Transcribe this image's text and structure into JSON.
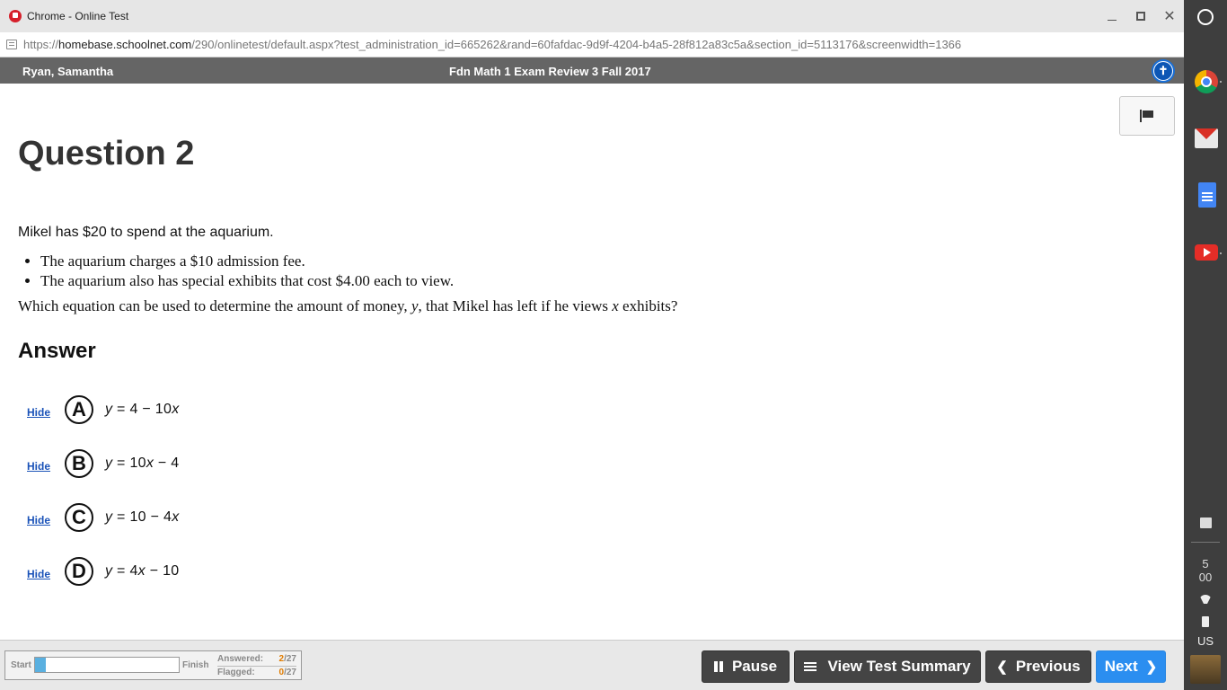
{
  "window": {
    "title": "Chrome - Online Test",
    "url_scheme": "https://",
    "url_host": "homebase.schoolnet.com",
    "url_path": "/290/onlinetest/default.aspx?test_administration_id=665262&rand=60fafdac-9d9f-4204-b4a5-28f812a83c5a&section_id=5113176&screenwidth=1366"
  },
  "header": {
    "student_name": "Ryan, Samantha",
    "exam_title": "Fdn Math 1 Exam Review 3 Fall 2017"
  },
  "question": {
    "title": "Question 2",
    "intro": "Mikel has $20 to spend at the aquarium.",
    "bullets": [
      "The aquarium charges a $10 admission fee.",
      "The aquarium also has special exhibits that cost $4.00 each to view."
    ],
    "prompt_parts": [
      "Which equation can be used to determine the amount of money, ",
      "y",
      ", that Mikel has left if he views ",
      "x",
      " exhibits?"
    ]
  },
  "answer": {
    "title": "Answer",
    "hide_label": "Hide",
    "choices": [
      {
        "letter": "A",
        "eq_parts": [
          "y",
          " = 4 − 10",
          "x",
          ""
        ]
      },
      {
        "letter": "B",
        "eq_parts": [
          "y",
          " = 10",
          "x",
          " − 4"
        ]
      },
      {
        "letter": "C",
        "eq_parts": [
          "y",
          " = 10 − 4",
          "x",
          ""
        ]
      },
      {
        "letter": "D",
        "eq_parts": [
          "y",
          " = 4",
          "x",
          " − 10"
        ]
      }
    ]
  },
  "footer": {
    "start_label": "Start",
    "finish_label": "Finish",
    "progress_fraction": 0.074,
    "answered_label": "Answered:",
    "answered_count": "2",
    "answered_total": "/27",
    "flagged_label": "Flagged:",
    "flagged_count": "0",
    "flagged_total": "/27",
    "pause_label": "Pause",
    "summary_label": "View Test Summary",
    "previous_label": "Previous",
    "next_label": "Next"
  },
  "shelf": {
    "clock_hour": "5",
    "clock_minute": "00",
    "keyboard_layout": "US"
  },
  "colors": {
    "header_bg": "#656565",
    "next_button": "#2b8ef0",
    "dark_button": "#444444",
    "progress_fill": "#5ab0e0",
    "count_accent": "#e07b00"
  }
}
